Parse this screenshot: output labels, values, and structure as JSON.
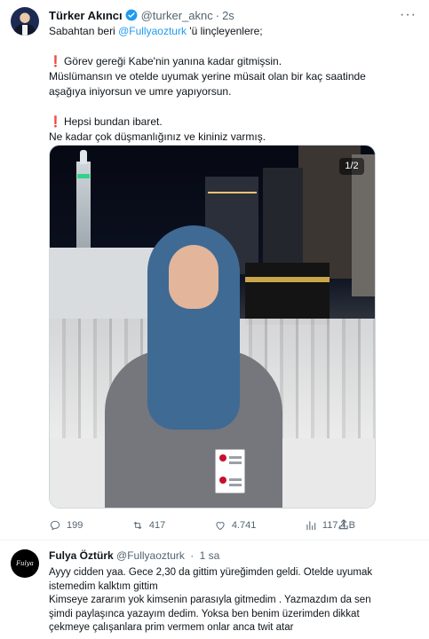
{
  "tweet": {
    "author_name": "Türker Akıncı",
    "handle": "@turker_aknc",
    "time": "2s",
    "lines": [
      "Sabahtan beri",
      "@Fullyaozturk",
      "'ü linçleyenlere;",
      "Görev gereği Kabe'nin yanına kadar gitmişsin.",
      "Müslümansın ve otelde uyumak yerine müsait olan bir kaç saatinde",
      "aşağıya iniyorsun ve umre yapıyorsun.",
      "Hepsi bundan ibaret.",
      "Ne kadar çok düşmanlığınız ve kininiz varmış."
    ],
    "media_counter": "1/2",
    "actions": {
      "replies": "199",
      "retweets": "417",
      "likes": "4.741",
      "views": "117,4 B"
    }
  },
  "reply": {
    "author_name": "Fulya Öztürk",
    "handle": "@Fullyaozturk",
    "time": "1 sa",
    "avatar_text": "Fulya",
    "lines": [
      "Ayyy cidden yaa. Gece 2,30 da gittim yüreğimden geldi. Otelde uyumak",
      "istemedim kalktım gittim",
      "Kimseye zararım yok kimsenin parasıyla gitmedim . Yazmazdım da sen",
      "şimdi paylaşınca yazayım dedim. Yoksa ben benim üzerimden dikkat",
      "çekmeye çalışanlara prim vermem onlar anca twit atar"
    ]
  },
  "colors": {
    "accent": "#1d9bf0",
    "text": "#0f1419",
    "muted": "#536471",
    "warning_mark": "#e0245e"
  },
  "icons": [
    "verified-badge-icon",
    "more-icon",
    "reply-icon",
    "retweet-icon",
    "like-icon",
    "views-icon",
    "share-icon",
    "exclamation-icon"
  ]
}
